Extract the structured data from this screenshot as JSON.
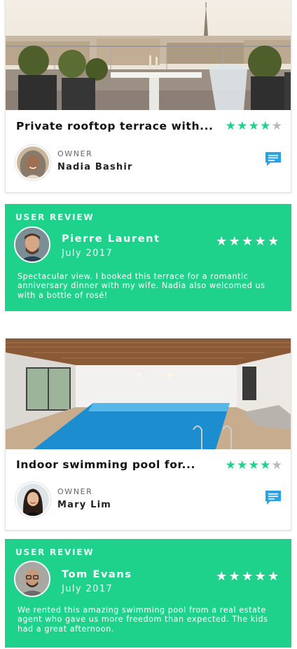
{
  "listings": [
    {
      "title": "Private rooftop terrace with...",
      "rating": 4,
      "max_rating": 5,
      "owner_label": "OWNER",
      "owner_name": "Nadia Bashir",
      "photo": "rooftop-terrace-paris-photo"
    },
    {
      "title": "Indoor swimming pool for...",
      "rating": 4,
      "max_rating": 5,
      "owner_label": "OWNER",
      "owner_name": "Mary Lim",
      "photo": "indoor-swimming-pool-photo"
    }
  ],
  "reviews": [
    {
      "label": "USER REVIEW",
      "name": "Pierre Laurent",
      "date": "July 2017",
      "rating": 5,
      "text": "Spectacular view. I booked this terrace for a romantic anniversary dinner with my wife. Nadia also welcomed us with a bottle of rosé!"
    },
    {
      "label": "USER REVIEW",
      "name": "Tom Evans",
      "date": "July 2017",
      "rating": 5,
      "text": "We rented this amazing swimming pool from a real estate agent who gave us more freedom than expected. The kids had a great afternoon."
    }
  ],
  "icons": {
    "star": "star-icon",
    "message": "chat-bubble-icon"
  },
  "colors": {
    "accent_green": "#1ed28c",
    "star_inactive": "#b9b9b9",
    "chat_blue": "#2aa3e6"
  }
}
